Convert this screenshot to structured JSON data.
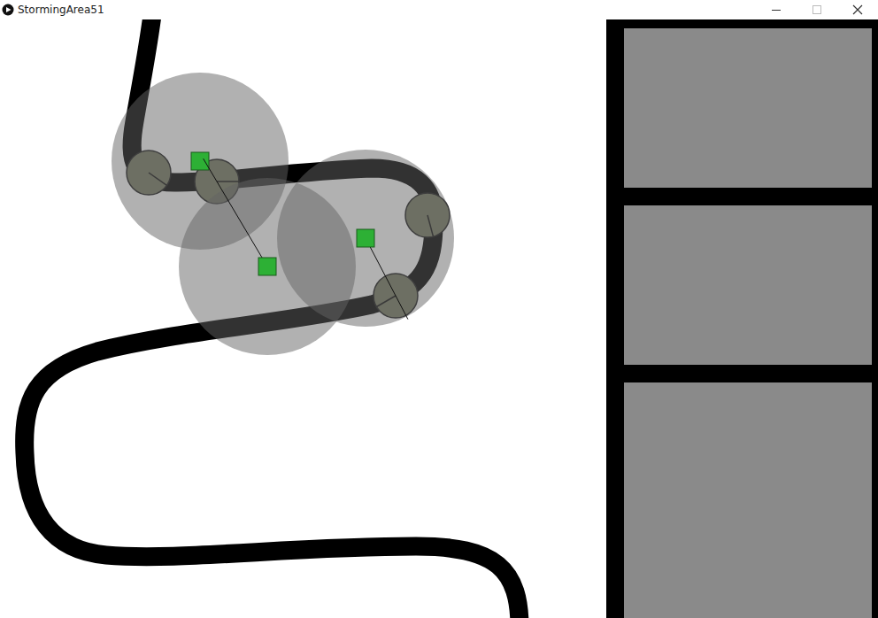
{
  "window": {
    "title": "StormingArea51"
  },
  "towers": [
    {
      "kind": "turret",
      "target": null
    },
    {
      "kind": "turret",
      "target": 3
    },
    {
      "kind": "turret",
      "target": 1
    }
  ],
  "enemies": [
    {
      "kind": "alien"
    },
    {
      "kind": "alien"
    },
    {
      "kind": "alien"
    },
    {
      "kind": "alien"
    }
  ],
  "shop": {
    "slots": [
      {
        "kind": "slot"
      },
      {
        "kind": "slot"
      },
      {
        "kind": "slot"
      }
    ]
  }
}
